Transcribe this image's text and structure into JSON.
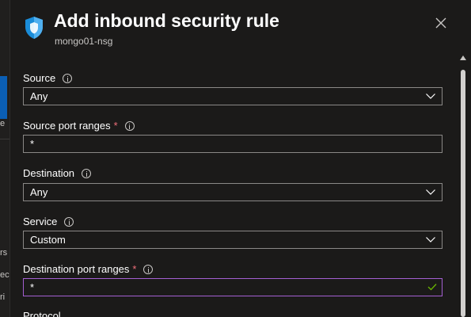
{
  "background_page": {
    "fragments": [
      "e",
      "rs",
      "ec",
      "ri"
    ]
  },
  "panel": {
    "title": "Add inbound security rule",
    "subtitle": "mongo01-nsg",
    "close_icon": "close-icon",
    "header_icon": "shield-icon"
  },
  "form": {
    "source": {
      "label": "Source",
      "value": "Any"
    },
    "source_port_ranges": {
      "label": "Source port ranges",
      "required_mark": "*",
      "value": "*"
    },
    "destination": {
      "label": "Destination",
      "value": "Any"
    },
    "service": {
      "label": "Service",
      "value": "Custom"
    },
    "destination_port_ranges": {
      "label": "Destination port ranges",
      "required_mark": "*",
      "value": "*"
    },
    "protocol": {
      "label": "Protocol"
    }
  },
  "colors": {
    "panel_bg": "#1b1a19",
    "accent": "#0b5fb5",
    "focus_border": "#a45fd1",
    "required": "#f1707b",
    "valid_check": "#6bb700"
  }
}
